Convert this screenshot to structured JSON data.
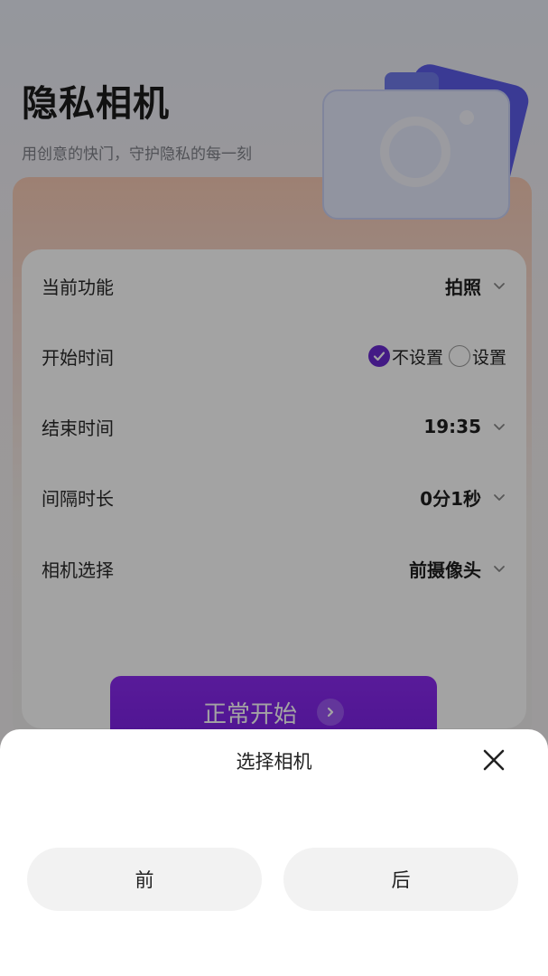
{
  "header": {
    "title": "隐私相机",
    "subtitle": "用创意的快门，守护隐私的每一刻"
  },
  "settings": {
    "function": {
      "label": "当前功能",
      "value": "拍照"
    },
    "start_time": {
      "label": "开始时间",
      "option_off": "不设置",
      "option_on": "设置",
      "selected": "不设置"
    },
    "end_time": {
      "label": "结束时间",
      "value": "19:35"
    },
    "interval": {
      "label": "间隔时长",
      "value": "0分1秒"
    },
    "camera": {
      "label": "相机选择",
      "value": "前摄像头"
    }
  },
  "start_button": {
    "label": "正常开始"
  },
  "sheet": {
    "title": "选择相机",
    "options": [
      {
        "label": "前"
      },
      {
        "label": "后"
      }
    ]
  },
  "colors": {
    "accent": "#7a1fe4",
    "sheet_bg": "#ffffff",
    "option_bg": "#f2f2f2"
  }
}
